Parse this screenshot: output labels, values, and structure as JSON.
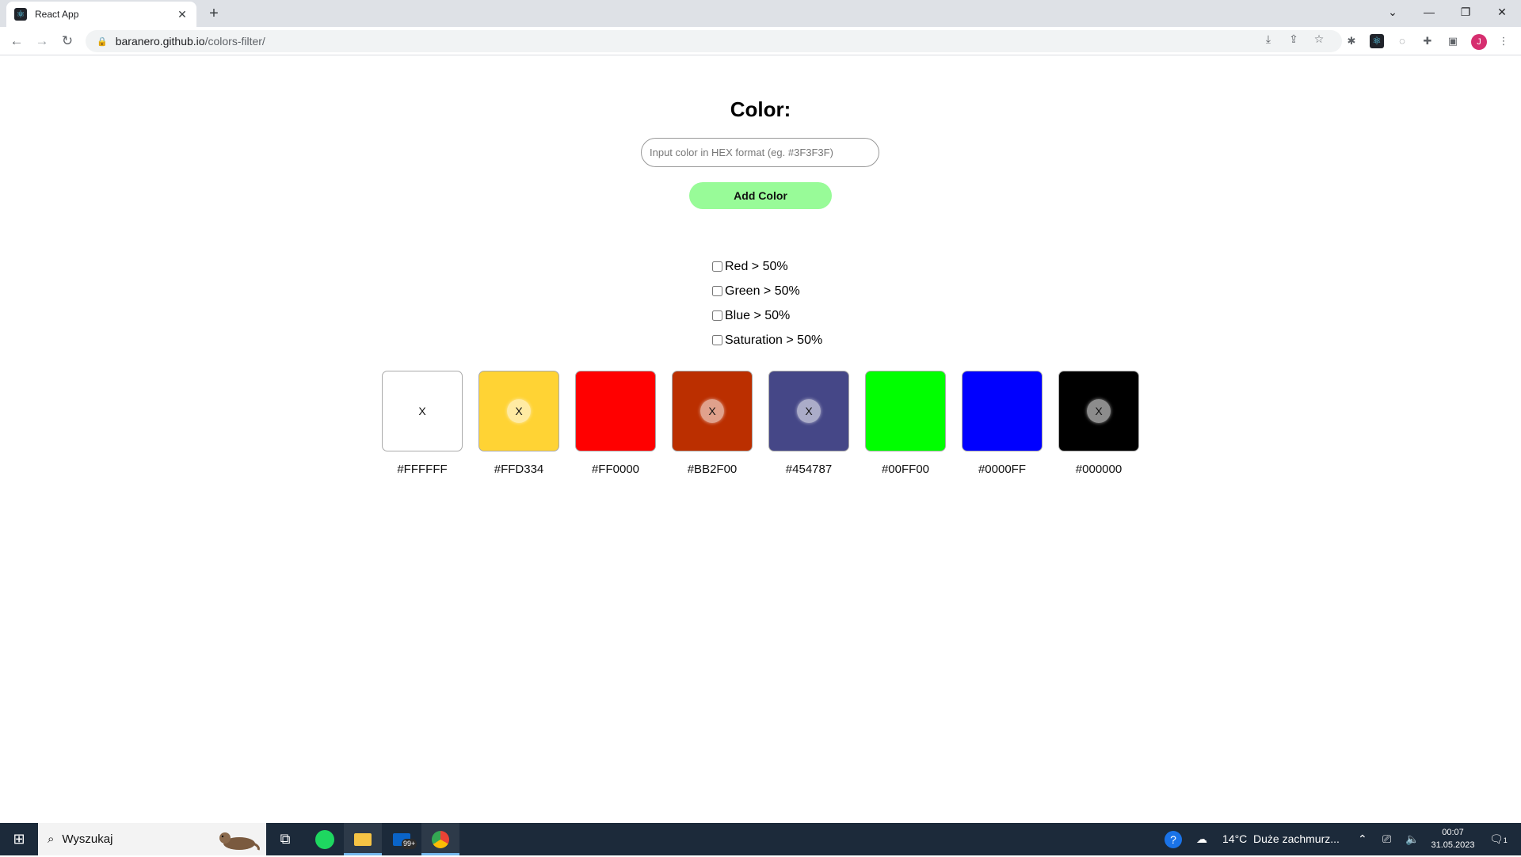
{
  "browser": {
    "tab_title": "React App",
    "url_domain": "baranero.github.io",
    "url_path": "/colors-filter/"
  },
  "page": {
    "heading": "Color:",
    "input_placeholder": "Input color in HEX format (eg. #3F3F3F)",
    "add_button": "Add Color",
    "filters": [
      {
        "label": "Red > 50%",
        "checked": false
      },
      {
        "label": "Green > 50%",
        "checked": false
      },
      {
        "label": "Blue > 50%",
        "checked": false
      },
      {
        "label": "Saturation > 50%",
        "checked": false
      }
    ],
    "colors": [
      {
        "hex": "#FFFFFF",
        "removable": true,
        "remove_label": "X"
      },
      {
        "hex": "#FFD334",
        "removable": true,
        "remove_label": "X"
      },
      {
        "hex": "#FF0000",
        "removable": false,
        "remove_label": ""
      },
      {
        "hex": "#BB2F00",
        "removable": true,
        "remove_label": "X"
      },
      {
        "hex": "#454787",
        "removable": true,
        "remove_label": "X"
      },
      {
        "hex": "#00FF00",
        "removable": false,
        "remove_label": ""
      },
      {
        "hex": "#0000FF",
        "removable": false,
        "remove_label": ""
      },
      {
        "hex": "#000000",
        "removable": true,
        "remove_label": "X"
      }
    ]
  },
  "taskbar": {
    "search_text": "Wyszukaj",
    "mail_badge": "99+",
    "weather_temp": "14°C",
    "weather_desc": "Duże zachmurz...",
    "time": "00:07",
    "date": "31.05.2023",
    "notification_count": "1"
  }
}
